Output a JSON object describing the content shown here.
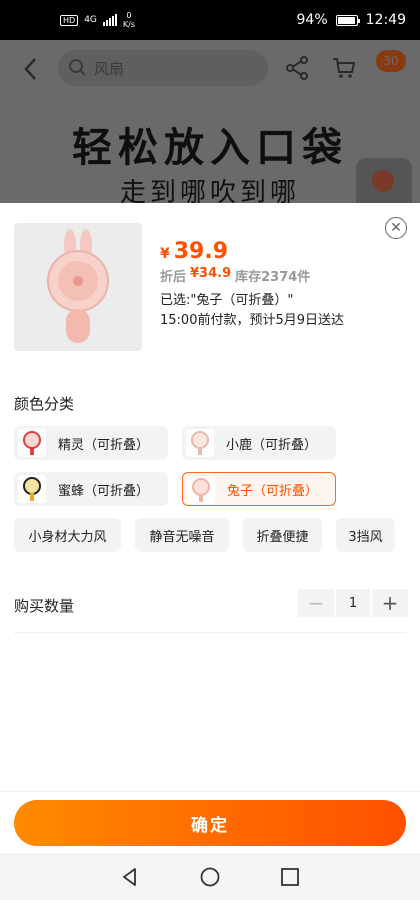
{
  "status_bar": {
    "net_speed_value": "0",
    "net_speed_unit": "K/s",
    "battery": "94%",
    "time": "12:49",
    "network_type": "4G",
    "hd": "HD"
  },
  "background_page": {
    "search_placeholder": "风扇",
    "cart_badge": "30",
    "headline": "轻松放入口袋",
    "subline": "走到哪吹到哪"
  },
  "product": {
    "currency": "¥",
    "price": "39.9",
    "discount_label": "折后",
    "discount_price": "¥34.9",
    "stock": "库存2374件",
    "selected": "已选:\"兔子（可折叠）\"",
    "delivery": "15:00前付款，预计5月9日送达"
  },
  "color_section": {
    "title": "颜色分类",
    "options": [
      {
        "label": "精灵（可折叠）",
        "icon": "fan-thumb-red"
      },
      {
        "label": "小鹿（可折叠）",
        "icon": "fan-thumb-pink"
      },
      {
        "label": "蜜蜂（可折叠）",
        "icon": "fan-thumb-bee"
      },
      {
        "label": "兔子（可折叠）",
        "icon": "fan-thumb-rabbit",
        "selected": true
      }
    ],
    "features": [
      "小身材大力风",
      "静音无噪音",
      "折叠便捷",
      "3挡风"
    ]
  },
  "quantity": {
    "label": "购买数量",
    "value": "1",
    "minus": "−",
    "plus": "+"
  },
  "confirm_label": "确定",
  "colors": {
    "accent": "#ff5000",
    "accent_gradient_start": "#ff8a00",
    "status_bar": "#000000",
    "overlay": "#6a6a6a"
  }
}
